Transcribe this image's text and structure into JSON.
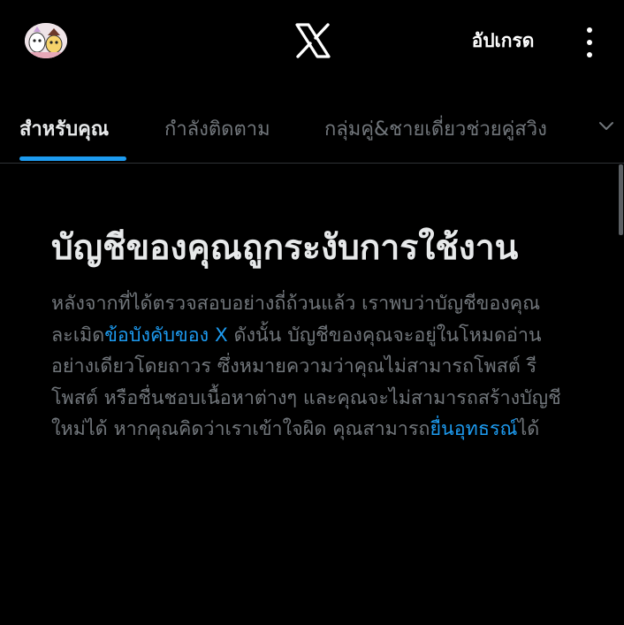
{
  "header": {
    "avatar": "avatar",
    "logo": "x-logo-icon",
    "upgrade_label": "อัปเกรด",
    "more": "more-vertical-icon"
  },
  "tabs": [
    {
      "label": "สำหรับคุณ",
      "active": true
    },
    {
      "label": "กำลังติดตาม",
      "active": false
    },
    {
      "label": "กลุ่มคู่&ชายเดี่ยวช่วยคู่สวิง",
      "active": false
    }
  ],
  "notice": {
    "title": "บัญชีของคุณถูกระงับการใช้งาน",
    "body_1": "หลังจากที่ได้ตรวจสอบอย่างถี่ถ้วนแล้ว เราพบว่าบัญชีของคุณละเมิด",
    "rules_link": "ข้อบังคับของ X",
    "body_2": " ดังนั้น บัญชีของคุณจะอยู่ในโหมดอ่านอย่างเดียวโดยถาวร ซึ่งหมายความว่าคุณไม่สามารถโพสต์ รีโพสต์ หรือชื่นชอบเนื้อหาต่างๆ และคุณจะไม่สามารถสร้างบัญชีใหม่ได้ หากคุณคิดว่าเราเข้าใจผิด คุณสามารถ",
    "appeal_link": "ยื่นอุทธรณ์",
    "body_3": "ได้"
  },
  "colors": {
    "background": "#000000",
    "accent": "#1d9bf0",
    "text_primary": "#e7e9ea",
    "text_secondary": "#71767b",
    "divider": "#2f3336"
  }
}
